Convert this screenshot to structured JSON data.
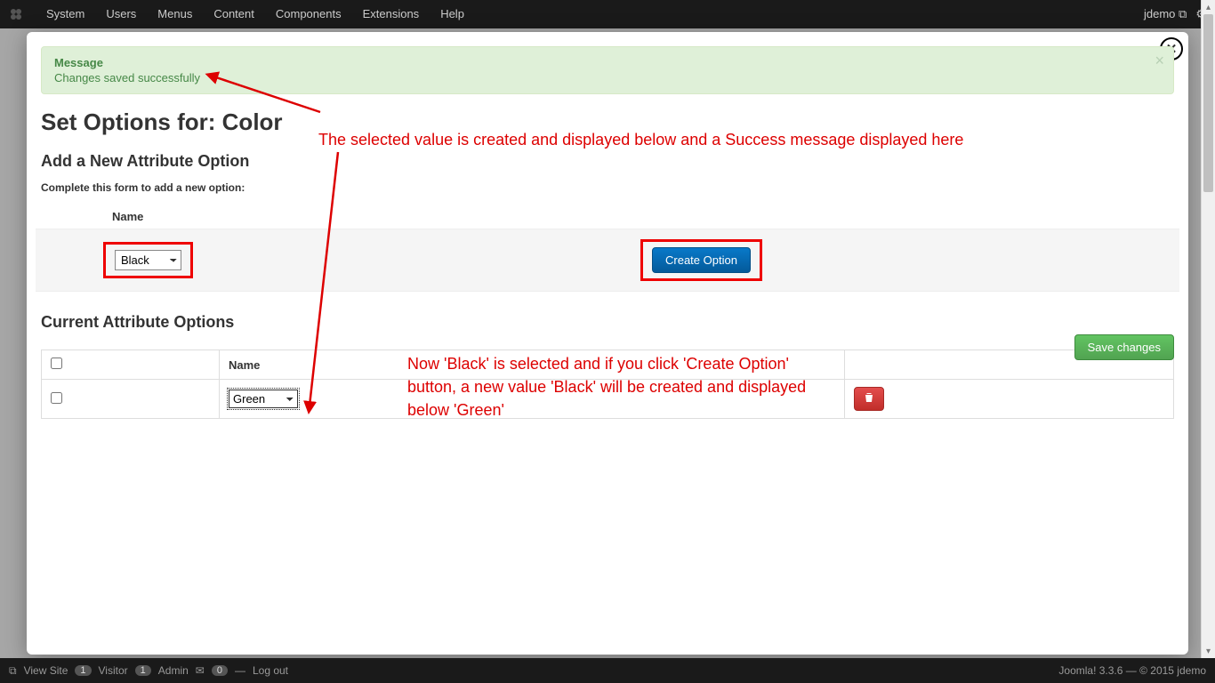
{
  "topbar": {
    "menu": [
      "System",
      "Users",
      "Menus",
      "Content",
      "Components",
      "Extensions",
      "Help"
    ],
    "user": "jdemo"
  },
  "alert": {
    "title": "Message",
    "text": "Changes saved successfully"
  },
  "page_title": "Set Options for: Color",
  "add_section": {
    "heading": "Add a New Attribute Option",
    "hint": "Complete this form to add a new option:",
    "name_label": "Name",
    "selected": "Black",
    "create_button": "Create Option"
  },
  "current_section": {
    "heading": "Current Attribute Options",
    "save_button": "Save changes",
    "columns": {
      "name": "Name"
    },
    "rows": [
      {
        "value": "Green"
      }
    ]
  },
  "annotations": {
    "a1": "The selected value is created and displayed below and a Success message displayed here",
    "a2": "Now 'Black' is selected and if you click 'Create Option' button, a new value 'Black' will be created and displayed below 'Green'"
  },
  "statusbar": {
    "view_site": "View Site",
    "visitor_count": "1",
    "visitor_label": "Visitor",
    "admin_count": "1",
    "admin_label": "Admin",
    "msg_count": "0",
    "logout": "Log out",
    "right": "Joomla! 3.3.6 — © 2015 jdemo"
  }
}
